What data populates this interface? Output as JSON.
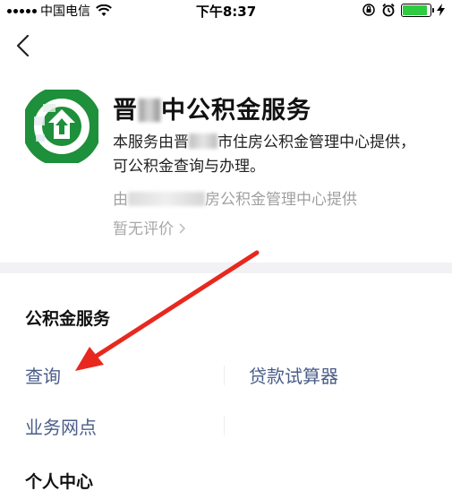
{
  "status_bar": {
    "carrier": "中国电信",
    "time": "下午8:37",
    "battery_level": 0.9,
    "colors": {
      "battery": "#2ecc40"
    }
  },
  "nav": {
    "back_icon": "chevron-left-icon"
  },
  "service": {
    "logo_icon": "housing-fund-logo-icon",
    "title_visible_start": "晋",
    "title_visible_end": "中公积金服务",
    "desc_part1": "本服务由晋",
    "desc_part2": "市住房公积金管理中心提供，可公积金查询与办理。",
    "provider_prefix": "由",
    "provider_suffix": "房公积金管理中心提供",
    "rating": "暂无评价"
  },
  "sections": {
    "gjj": {
      "title": "公积金服务",
      "items": [
        "查询",
        "贷款试算器",
        "业务网点"
      ]
    },
    "personal": {
      "title": "个人中心"
    }
  },
  "annotation": {
    "icon": "red-arrow-icon",
    "color": "#e8281e"
  },
  "colors": {
    "link": "#4a5d8a",
    "divider": "#f2f2f4"
  }
}
